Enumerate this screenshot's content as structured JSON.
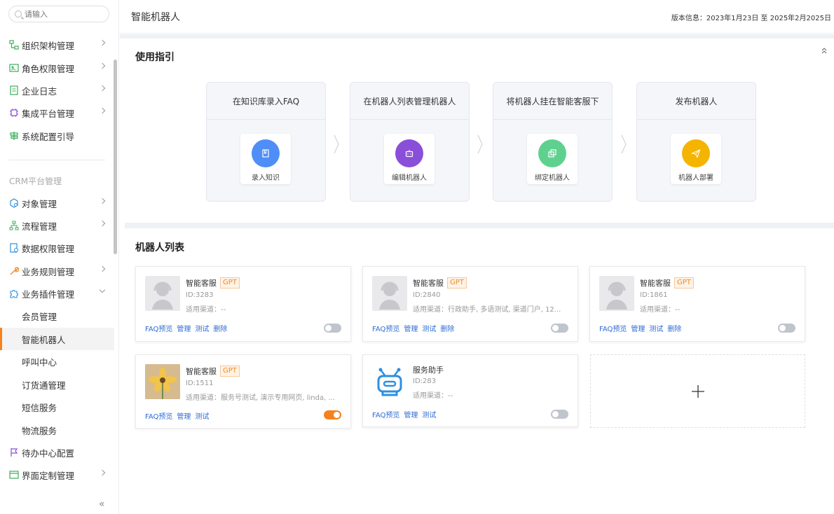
{
  "search": {
    "placeholder": "请输入"
  },
  "sidebar": {
    "items": [
      {
        "label": "组织架构管理"
      },
      {
        "label": "角色权限管理"
      },
      {
        "label": "企业日志"
      },
      {
        "label": "集成平台管理"
      },
      {
        "label": "系统配置引导"
      }
    ],
    "section": "CRM平台管理",
    "crm_items": [
      {
        "label": "对象管理"
      },
      {
        "label": "流程管理"
      },
      {
        "label": "数据权限管理"
      },
      {
        "label": "业务规则管理"
      },
      {
        "label": "业务插件管理"
      }
    ],
    "sub_items": [
      {
        "label": "会员管理"
      },
      {
        "label": "智能机器人"
      },
      {
        "label": "呼叫中心"
      },
      {
        "label": "订货通管理"
      },
      {
        "label": "短信服务"
      },
      {
        "label": "物流服务"
      }
    ],
    "bottom_items": [
      {
        "label": "待办中心配置"
      },
      {
        "label": "界面定制管理"
      }
    ],
    "collapse": "«"
  },
  "header": {
    "title": "智能机器人",
    "version": "版本信息：2023年1月23日 至 2025年2月2025日"
  },
  "guide": {
    "title": "使用指引",
    "steps": [
      {
        "title": "在知识库录入FAQ",
        "action": "录入知识",
        "color": "#4f8ef7"
      },
      {
        "title": "在机器人列表管理机器人",
        "action": "编辑机器人",
        "color": "#8a4fd8"
      },
      {
        "title": "将机器人挂在智能客服下",
        "action": "绑定机器人",
        "color": "#5fd18f"
      },
      {
        "title": "发布机器人",
        "action": "机器人部署",
        "color": "#f5b400"
      }
    ]
  },
  "robots": {
    "title": "机器人列表",
    "cards": [
      {
        "name": "智能客服",
        "gpt": "GPT",
        "id": "ID:3283",
        "channels": "适用渠道：--",
        "actions": [
          "FAQ预览",
          "管理",
          "测试",
          "删除"
        ],
        "enabled": false
      },
      {
        "name": "智能客服",
        "gpt": "GPT",
        "id": "ID:2840",
        "channels": "适用渠道：行政助手, 多语测试, 渠道门户, 12...",
        "actions": [
          "FAQ预览",
          "管理",
          "测试",
          "删除"
        ],
        "enabled": false
      },
      {
        "name": "智能客服",
        "gpt": "GPT",
        "id": "ID:1861",
        "channels": "适用渠道：--",
        "actions": [
          "FAQ预览",
          "管理",
          "测试",
          "删除"
        ],
        "enabled": false
      },
      {
        "name": "智能客服",
        "gpt": "GPT",
        "id": "ID:1511",
        "channels": "适用渠道：服务号测试, 演示专用网页, linda, ...",
        "actions": [
          "FAQ预览",
          "管理",
          "测试"
        ],
        "enabled": true
      },
      {
        "name": "服务助手",
        "gpt": "",
        "id": "ID:283",
        "channels": "适用渠道：--",
        "actions": [
          "FAQ预览",
          "管理",
          "测试"
        ],
        "enabled": false
      }
    ]
  }
}
